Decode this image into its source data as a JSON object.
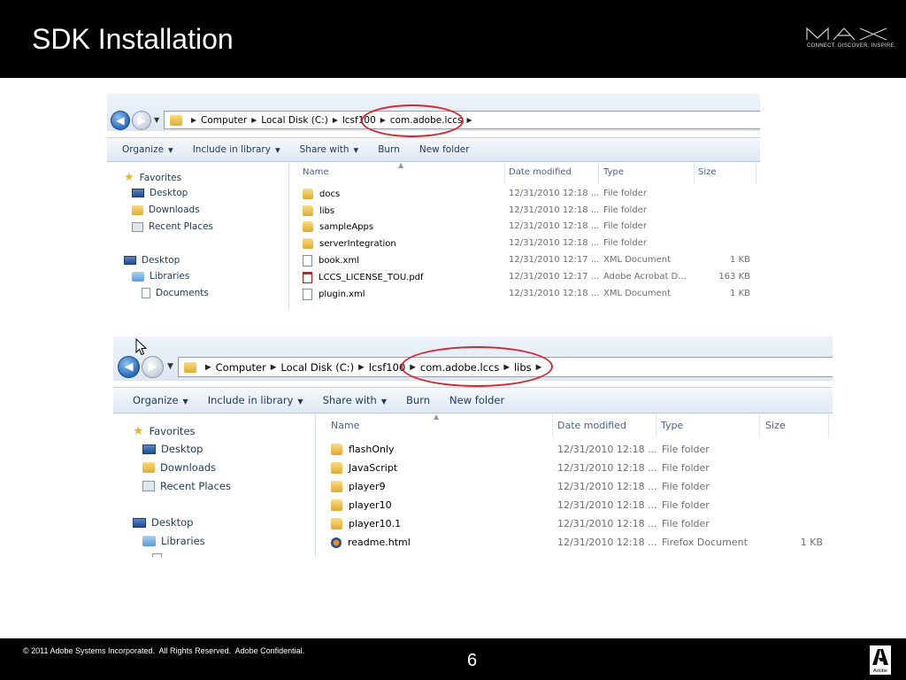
{
  "slide": {
    "title": "SDK Installation",
    "logo_text": "MAX",
    "logo_tagline": "CONNECT. DISCOVER. INSPIRE.",
    "copyright": "© 2011 Adobe Systems Incorporated.  All Rights Reserved.  Adobe Confidential.",
    "page_number": "6",
    "adobe_logo": "Adobe"
  },
  "window1": {
    "breadcrumbs": [
      "Computer",
      "Local Disk (C:)",
      "lcsf100",
      "com.adobe.lccs"
    ],
    "commands": [
      "Organize",
      "Include in library",
      "Share with",
      "Burn",
      "New folder"
    ],
    "nav_items": [
      {
        "label": "Favorites",
        "icon": "star-icon"
      },
      {
        "label": "Desktop",
        "icon": "desktop-icon"
      },
      {
        "label": "Downloads",
        "icon": "downloads-icon"
      },
      {
        "label": "Recent Places",
        "icon": "recent-places-icon"
      },
      {
        "label": "Desktop",
        "icon": "desktop-icon"
      },
      {
        "label": "Libraries",
        "icon": "libraries-icon"
      },
      {
        "label": "Documents",
        "icon": "documents-icon"
      }
    ],
    "columns": [
      "Name",
      "Date modified",
      "Type",
      "Size"
    ],
    "files": [
      {
        "name": "docs",
        "date": "12/31/2010 12:18 ...",
        "type": "File folder",
        "size": "",
        "icon": "folder-icon"
      },
      {
        "name": "libs",
        "date": "12/31/2010 12:18 ...",
        "type": "File folder",
        "size": "",
        "icon": "folder-icon"
      },
      {
        "name": "sampleApps",
        "date": "12/31/2010 12:18 ...",
        "type": "File folder",
        "size": "",
        "icon": "folder-icon"
      },
      {
        "name": "serverIntegration",
        "date": "12/31/2010 12:18 ...",
        "type": "File folder",
        "size": "",
        "icon": "folder-icon"
      },
      {
        "name": "book.xml",
        "date": "12/31/2010 12:17 ...",
        "type": "XML Document",
        "size": "1 KB",
        "icon": "xml-file-icon"
      },
      {
        "name": "LCCS_LICENSE_TOU.pdf",
        "date": "12/31/2010 12:17 ...",
        "type": "Adobe Acrobat D...",
        "size": "163 KB",
        "icon": "pdf-file-icon"
      },
      {
        "name": "plugin.xml",
        "date": "12/31/2010 12:18 ...",
        "type": "XML Document",
        "size": "1 KB",
        "icon": "xml-file-icon"
      }
    ]
  },
  "window2": {
    "breadcrumbs": [
      "Computer",
      "Local Disk (C:)",
      "lcsf100",
      "com.adobe.lccs",
      "libs"
    ],
    "commands": [
      "Organize",
      "Include in library",
      "Share with",
      "Burn",
      "New folder"
    ],
    "nav_items": [
      {
        "label": "Favorites",
        "icon": "star-icon"
      },
      {
        "label": "Desktop",
        "icon": "desktop-icon"
      },
      {
        "label": "Downloads",
        "icon": "downloads-icon"
      },
      {
        "label": "Recent Places",
        "icon": "recent-places-icon"
      },
      {
        "label": "Desktop",
        "icon": "desktop-icon"
      },
      {
        "label": "Libraries",
        "icon": "libraries-icon"
      }
    ],
    "columns": [
      "Name",
      "Date modified",
      "Type",
      "Size"
    ],
    "files": [
      {
        "name": "flashOnly",
        "date": "12/31/2010 12:18 ...",
        "type": "File folder",
        "size": "",
        "icon": "folder-icon"
      },
      {
        "name": "JavaScript",
        "date": "12/31/2010 12:18 ...",
        "type": "File folder",
        "size": "",
        "icon": "folder-icon"
      },
      {
        "name": "player9",
        "date": "12/31/2010 12:18 ...",
        "type": "File folder",
        "size": "",
        "icon": "folder-icon"
      },
      {
        "name": "player10",
        "date": "12/31/2010 12:18 ...",
        "type": "File folder",
        "size": "",
        "icon": "folder-icon"
      },
      {
        "name": "player10.1",
        "date": "12/31/2010 12:18 ...",
        "type": "File folder",
        "size": "",
        "icon": "folder-icon"
      },
      {
        "name": "readme.html",
        "date": "12/31/2010 12:18 ...",
        "type": "Firefox Document",
        "size": "1 KB",
        "icon": "html-file-icon"
      }
    ]
  },
  "colors": {
    "highlight_circle": "#d4262e",
    "explorer_text": "#1e395b"
  }
}
